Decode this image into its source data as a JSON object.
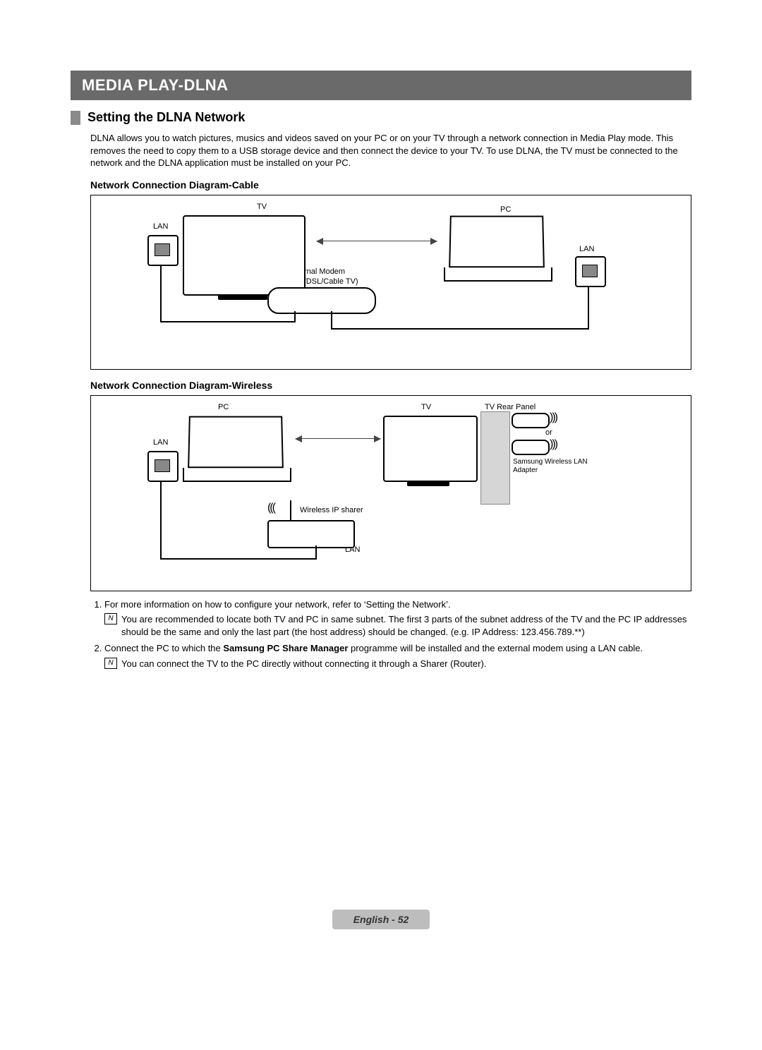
{
  "titleBar": "MEDIA PLAY-DLNA",
  "section": {
    "title": "Setting the DLNA Network",
    "intro": "DLNA allows you to watch pictures, musics and videos saved on your PC or on your TV through a network connection in Media Play mode. This removes the need to copy them to a USB storage device and then connect the device to your TV. To use DLNA, the TV must be connected to the network and the DLNA application must be installed on your PC."
  },
  "diagram1": {
    "heading": "Network Connection Diagram-Cable",
    "labels": {
      "tv": "TV",
      "pc": "PC",
      "lan": "LAN",
      "modem1": "External Modem",
      "modem2": "(ADSL/VDSL/Cable TV)"
    }
  },
  "diagram2": {
    "heading": "Network Connection Diagram-Wireless",
    "labels": {
      "pc": "PC",
      "tv": "TV",
      "rear": "TV Rear Panel",
      "lan": "LAN",
      "or": "or",
      "adapter1": "Samsung Wireless LAN",
      "adapter2": "Adapter",
      "wifi": "Wireless IP sharer"
    }
  },
  "instructions": {
    "item1": "For more information on how to configure your network, refer to ‘Setting the Network’.",
    "note1": "You are recommended to locate both TV and PC in same subnet. The first 3 parts of the subnet address of the TV and the PC IP addresses should be the same and only the last part (the host address) should be changed. (e.g. IP Address: 123.456.789.**)",
    "item2_a": "Connect the PC to which the ",
    "item2_b": "Samsung PC Share Manager",
    "item2_c": " programme will be installed and the external modem using a LAN cable.",
    "note2": "You can connect the TV to the PC directly without connecting it through a Sharer (Router)."
  },
  "footer": "English - 52"
}
